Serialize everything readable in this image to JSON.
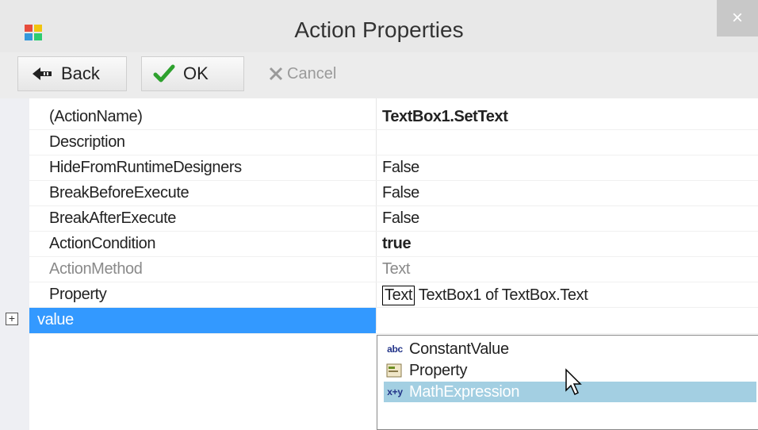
{
  "window": {
    "title": "Action Properties",
    "close_label": "×"
  },
  "toolbar": {
    "back_label": "Back",
    "ok_label": "OK",
    "cancel_label": "Cancel"
  },
  "properties": [
    {
      "name": "(ActionName)",
      "value": "TextBox1.SetText",
      "value_bold": true
    },
    {
      "name": "Description",
      "value": ""
    },
    {
      "name": "HideFromRuntimeDesigners",
      "value": "False"
    },
    {
      "name": "BreakBeforeExecute",
      "value": "False"
    },
    {
      "name": "BreakAfterExecute",
      "value": "False"
    },
    {
      "name": "ActionCondition",
      "value": "true",
      "value_bold": true
    },
    {
      "name": "ActionMethod",
      "value": "Text",
      "dim": true
    },
    {
      "name": "Property",
      "value_prefix": "Text",
      "value_suffix": "TextBox1 of TextBox.Text"
    },
    {
      "name": "value",
      "value": "",
      "selected": true,
      "expander": "+"
    }
  ],
  "dropdown": {
    "items": [
      {
        "label": "ConstantValue",
        "icon": "abc"
      },
      {
        "label": "Property",
        "icon": "property-icon"
      },
      {
        "label": "MathExpression",
        "icon": "x+y",
        "highlighted": true
      }
    ]
  },
  "colors": {
    "selection": "#3399ff",
    "dropdown_highlight": "#a3cfe2"
  }
}
